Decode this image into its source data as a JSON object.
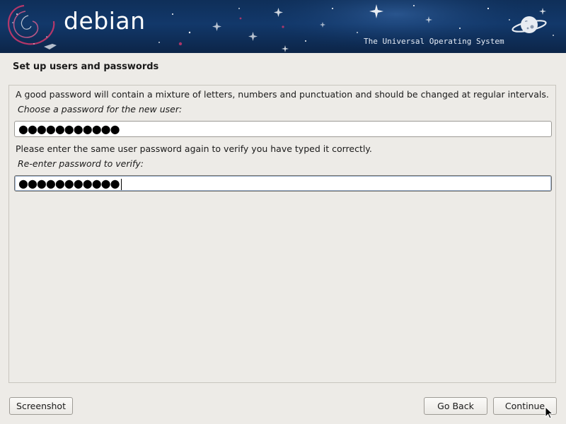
{
  "banner": {
    "logo_text": "debian",
    "tagline": "The Universal Operating System"
  },
  "page": {
    "title": "Set up users and passwords"
  },
  "content": {
    "help_text": "A good password will contain a mixture of letters, numbers and punctuation and should be changed at regular intervals.",
    "password_label": "Choose a password for the new user:",
    "password_value": "●●●●●●●●●●●",
    "verify_text": "Please enter the same user password again to verify you have typed it correctly.",
    "verify_label": "Re-enter password to verify:",
    "verify_value": "●●●●●●●●●●●"
  },
  "buttons": {
    "screenshot": "Screenshot",
    "go_back": "Go Back",
    "continue": "Continue"
  },
  "icons": {
    "swirl": "debian-swirl-icon",
    "planet": "planet-icon",
    "cursor": "mouse-pointer-icon"
  },
  "colors": {
    "banner_bg": "#12386a",
    "page_bg": "#edebe7",
    "swirl": "#d2386c"
  }
}
